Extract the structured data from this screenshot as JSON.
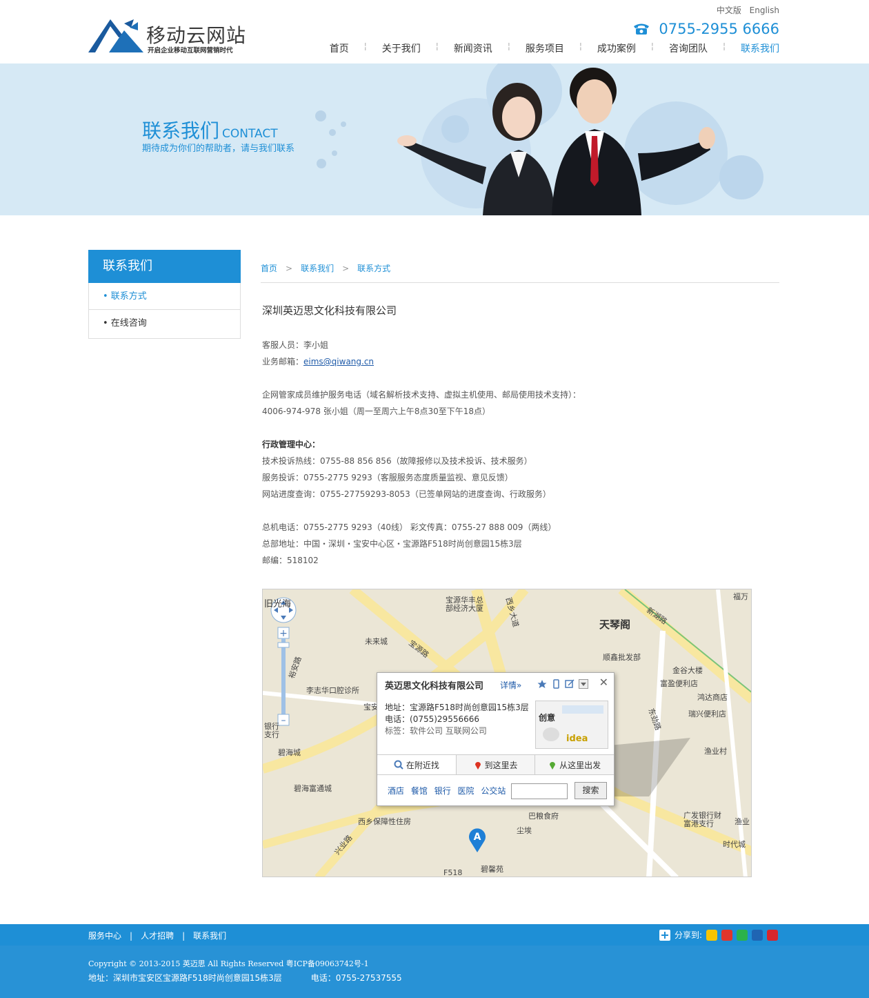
{
  "header": {
    "logo_title": "移动云网站",
    "logo_subtitle": "开启企业移动互联网营销时代",
    "lang": [
      "中文版",
      "English"
    ],
    "phone": "0755-2955 6666",
    "nav": [
      "首页",
      "关于我们",
      "新闻资讯",
      "服务项目",
      "成功案例",
      "咨询团队",
      "联系我们"
    ],
    "active_nav": "联系我们"
  },
  "banner": {
    "title": "联系我们",
    "title_en": "CONTACT",
    "subtitle": "期待成为你们的帮助者，请与我们联系"
  },
  "sidebar": {
    "title": "联系我们",
    "items": [
      "• 联系方式",
      "• 在线咨询"
    ]
  },
  "breadcrumb": [
    "首页",
    "联系我们",
    "联系方式"
  ],
  "content": {
    "company": "深圳英迈思文化科技有限公司",
    "service_person": "客服人员：李小姐",
    "email_label": "业务邮箱：",
    "email": "eims@qiwang.cn",
    "support_title": "企网管家成员维护服务电话（域名解析技术支持、虚拟主机使用、邮局使用技术支持）：",
    "support_line": "4006-974-978 张小姐（周一至周六上午8点30至下午18点）",
    "admin_title": "行政管理中心：",
    "admin_lines": [
      "技术投诉热线：0755-88 856 856（故障报修以及技术投诉、技术服务）",
      "服务投诉：0755-2775 9293（客服服务态度质量监视、意见反馈）",
      "网站进度查询：0755-27759293-8053（已签单网站的进度查询、行政服务）"
    ],
    "hq_lines": [
      "总机电话：0755-2775 9293（40线） 彩文传真：0755-27 888 009（两线）",
      "总部地址：中国・深圳・宝安中心区・宝源路F518时尚创意园15栋3层",
      "邮编：518102"
    ]
  },
  "map": {
    "popup_title": "英迈思文化科技有限公司",
    "popup_more": "详情»",
    "address_label": "地址：",
    "address": "宝源路F518时尚创意园15栋3层",
    "phone_label": "电话：",
    "phone": "(0755)29556666",
    "tags_label": "标签：",
    "tags": "软件公司 互联网公司",
    "tabs": [
      "在附近找",
      "到这里去",
      "从这里出发"
    ],
    "nearby": [
      "酒店",
      "餐馆",
      "银行",
      "医院",
      "公交站"
    ],
    "search_button": "搜索",
    "marker_letter": "A",
    "labels": [
      "天琴阁",
      "宝源华丰总部经济大厦",
      "未来城",
      "顺鑫批发部",
      "金谷大楼",
      "富盈便利店",
      "鸿达商店",
      "瑞兴便利店",
      "渔业村",
      "李志华口腔诊所",
      "碧海城",
      "碧海富通城",
      "西乡保障性住房",
      "巴粮食府",
      "尘埃",
      "碧馨苑",
      "广发银行财富港支行",
      "时代城",
      "F518",
      "新湖路",
      "宝源路",
      "西乡大道",
      "兴业路",
      "宝安",
      "银行支行",
      "旧光海",
      "福万",
      "渔业",
      "东劲路",
      "裕安路"
    ]
  },
  "footer": {
    "links": [
      "服务中心",
      "人才招聘",
      "联系我们"
    ],
    "share_label": "分享到:",
    "copyright": "Copyright © 2013-2015 英迈思 All Rights Reserved 粤ICP备09063742号-1",
    "address": "地址：深圳市宝安区宝源路F518时尚创意园15栋3层",
    "tel": "电话：0755-27537555"
  },
  "colors": {
    "accent": "#1e8fd6",
    "banner_bg": "#d6e9f5",
    "footer": "#2892d6"
  }
}
